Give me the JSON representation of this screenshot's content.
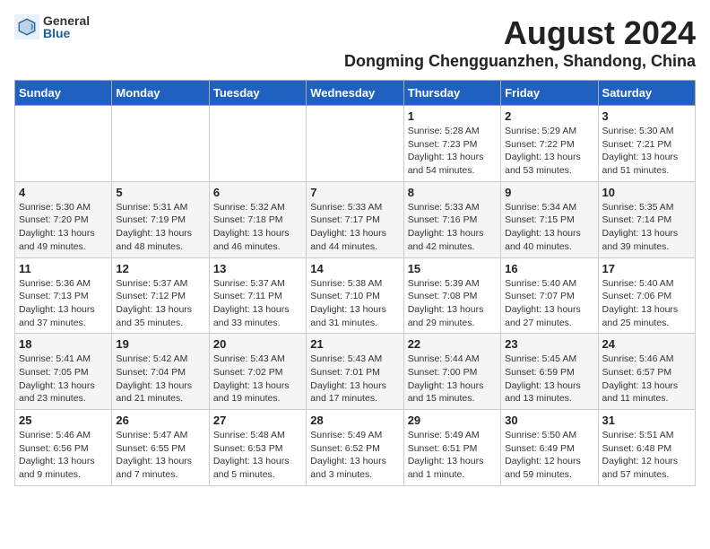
{
  "header": {
    "logo_general": "General",
    "logo_blue": "Blue",
    "main_title": "August 2024",
    "sub_title": "Dongming Chengguanzhen, Shandong, China"
  },
  "weekdays": [
    "Sunday",
    "Monday",
    "Tuesday",
    "Wednesday",
    "Thursday",
    "Friday",
    "Saturday"
  ],
  "weeks": [
    [
      {
        "day": "",
        "info": ""
      },
      {
        "day": "",
        "info": ""
      },
      {
        "day": "",
        "info": ""
      },
      {
        "day": "",
        "info": ""
      },
      {
        "day": "1",
        "info": "Sunrise: 5:28 AM\nSunset: 7:23 PM\nDaylight: 13 hours\nand 54 minutes."
      },
      {
        "day": "2",
        "info": "Sunrise: 5:29 AM\nSunset: 7:22 PM\nDaylight: 13 hours\nand 53 minutes."
      },
      {
        "day": "3",
        "info": "Sunrise: 5:30 AM\nSunset: 7:21 PM\nDaylight: 13 hours\nand 51 minutes."
      }
    ],
    [
      {
        "day": "4",
        "info": "Sunrise: 5:30 AM\nSunset: 7:20 PM\nDaylight: 13 hours\nand 49 minutes."
      },
      {
        "day": "5",
        "info": "Sunrise: 5:31 AM\nSunset: 7:19 PM\nDaylight: 13 hours\nand 48 minutes."
      },
      {
        "day": "6",
        "info": "Sunrise: 5:32 AM\nSunset: 7:18 PM\nDaylight: 13 hours\nand 46 minutes."
      },
      {
        "day": "7",
        "info": "Sunrise: 5:33 AM\nSunset: 7:17 PM\nDaylight: 13 hours\nand 44 minutes."
      },
      {
        "day": "8",
        "info": "Sunrise: 5:33 AM\nSunset: 7:16 PM\nDaylight: 13 hours\nand 42 minutes."
      },
      {
        "day": "9",
        "info": "Sunrise: 5:34 AM\nSunset: 7:15 PM\nDaylight: 13 hours\nand 40 minutes."
      },
      {
        "day": "10",
        "info": "Sunrise: 5:35 AM\nSunset: 7:14 PM\nDaylight: 13 hours\nand 39 minutes."
      }
    ],
    [
      {
        "day": "11",
        "info": "Sunrise: 5:36 AM\nSunset: 7:13 PM\nDaylight: 13 hours\nand 37 minutes."
      },
      {
        "day": "12",
        "info": "Sunrise: 5:37 AM\nSunset: 7:12 PM\nDaylight: 13 hours\nand 35 minutes."
      },
      {
        "day": "13",
        "info": "Sunrise: 5:37 AM\nSunset: 7:11 PM\nDaylight: 13 hours\nand 33 minutes."
      },
      {
        "day": "14",
        "info": "Sunrise: 5:38 AM\nSunset: 7:10 PM\nDaylight: 13 hours\nand 31 minutes."
      },
      {
        "day": "15",
        "info": "Sunrise: 5:39 AM\nSunset: 7:08 PM\nDaylight: 13 hours\nand 29 minutes."
      },
      {
        "day": "16",
        "info": "Sunrise: 5:40 AM\nSunset: 7:07 PM\nDaylight: 13 hours\nand 27 minutes."
      },
      {
        "day": "17",
        "info": "Sunrise: 5:40 AM\nSunset: 7:06 PM\nDaylight: 13 hours\nand 25 minutes."
      }
    ],
    [
      {
        "day": "18",
        "info": "Sunrise: 5:41 AM\nSunset: 7:05 PM\nDaylight: 13 hours\nand 23 minutes."
      },
      {
        "day": "19",
        "info": "Sunrise: 5:42 AM\nSunset: 7:04 PM\nDaylight: 13 hours\nand 21 minutes."
      },
      {
        "day": "20",
        "info": "Sunrise: 5:43 AM\nSunset: 7:02 PM\nDaylight: 13 hours\nand 19 minutes."
      },
      {
        "day": "21",
        "info": "Sunrise: 5:43 AM\nSunset: 7:01 PM\nDaylight: 13 hours\nand 17 minutes."
      },
      {
        "day": "22",
        "info": "Sunrise: 5:44 AM\nSunset: 7:00 PM\nDaylight: 13 hours\nand 15 minutes."
      },
      {
        "day": "23",
        "info": "Sunrise: 5:45 AM\nSunset: 6:59 PM\nDaylight: 13 hours\nand 13 minutes."
      },
      {
        "day": "24",
        "info": "Sunrise: 5:46 AM\nSunset: 6:57 PM\nDaylight: 13 hours\nand 11 minutes."
      }
    ],
    [
      {
        "day": "25",
        "info": "Sunrise: 5:46 AM\nSunset: 6:56 PM\nDaylight: 13 hours\nand 9 minutes."
      },
      {
        "day": "26",
        "info": "Sunrise: 5:47 AM\nSunset: 6:55 PM\nDaylight: 13 hours\nand 7 minutes."
      },
      {
        "day": "27",
        "info": "Sunrise: 5:48 AM\nSunset: 6:53 PM\nDaylight: 13 hours\nand 5 minutes."
      },
      {
        "day": "28",
        "info": "Sunrise: 5:49 AM\nSunset: 6:52 PM\nDaylight: 13 hours\nand 3 minutes."
      },
      {
        "day": "29",
        "info": "Sunrise: 5:49 AM\nSunset: 6:51 PM\nDaylight: 13 hours\nand 1 minute."
      },
      {
        "day": "30",
        "info": "Sunrise: 5:50 AM\nSunset: 6:49 PM\nDaylight: 12 hours\nand 59 minutes."
      },
      {
        "day": "31",
        "info": "Sunrise: 5:51 AM\nSunset: 6:48 PM\nDaylight: 12 hours\nand 57 minutes."
      }
    ]
  ]
}
